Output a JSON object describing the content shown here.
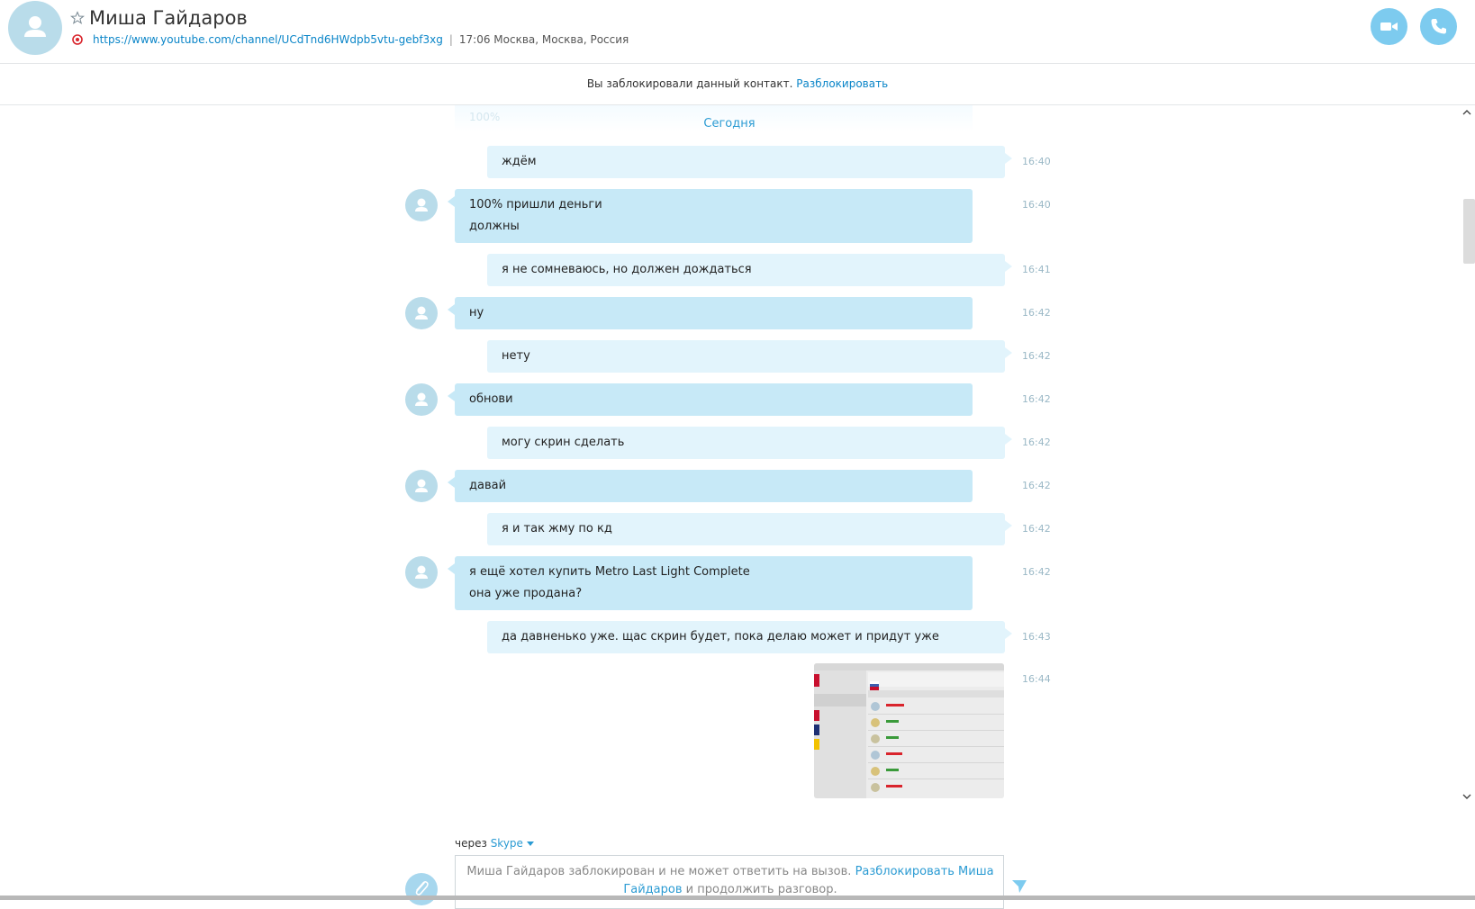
{
  "header": {
    "contact_name": "Миша Гайдаров",
    "profile_url": "https://www.youtube.com/channel/UCdTnd6HWdpb5vtu-gebf3xg",
    "separator": "|",
    "local_time": "17:06 Москва, Москва, Россия"
  },
  "blocked_banner": {
    "text": "Вы заблокировали данный контакт.",
    "unblock_label": "Разблокировать"
  },
  "chat": {
    "faded_top_text": "100%",
    "day_separator": "Сегодня",
    "messages": [
      {
        "dir": "out",
        "lines": [
          "ждём"
        ],
        "time": "16:40"
      },
      {
        "dir": "in",
        "lines": [
          "100% пришли деньги",
          "должны"
        ],
        "time": "16:40"
      },
      {
        "dir": "out",
        "lines": [
          "я не сомневаюсь, но должен дождаться"
        ],
        "time": "16:41"
      },
      {
        "dir": "in",
        "lines": [
          "ну"
        ],
        "time": "16:42"
      },
      {
        "dir": "out",
        "lines": [
          "нету"
        ],
        "time": "16:42"
      },
      {
        "dir": "in",
        "lines": [
          "обнови"
        ],
        "time": "16:42"
      },
      {
        "dir": "out",
        "lines": [
          "могу скрин сделать"
        ],
        "time": "16:42"
      },
      {
        "dir": "in",
        "lines": [
          "давай"
        ],
        "time": "16:42"
      },
      {
        "dir": "out",
        "lines": [
          "я и так жму по кд"
        ],
        "time": "16:42"
      },
      {
        "dir": "in",
        "lines": [
          "я ещё хотел купить Metro Last Light Complete",
          "она уже продана?"
        ],
        "time": "16:42"
      },
      {
        "dir": "out",
        "lines": [
          "да давненько уже. щас скрин будет, пока делаю может и придут уже"
        ],
        "time": "16:43"
      }
    ],
    "image_message": {
      "time": "16:44"
    }
  },
  "composer": {
    "via_label": "через",
    "via_service": "Skype",
    "blocked_notice_start": "Миша Гайдаров заблокирован и не может ответить на вызов.",
    "unblock_link": "Разблокировать Миша Гайдаров",
    "blocked_notice_end": "и продолжить разговор."
  },
  "colors": {
    "accent": "#0a85c8",
    "incoming_bubble": "#c7e9f7",
    "outgoing_bubble": "#e2f4fc",
    "call_button": "#7dcbef"
  },
  "icons": [
    "user-avatar-icon",
    "star-icon",
    "mood-icon",
    "video-call-icon",
    "phone-call-icon",
    "attach-icon",
    "send-icon",
    "scroll-up-icon",
    "scroll-down-icon"
  ]
}
